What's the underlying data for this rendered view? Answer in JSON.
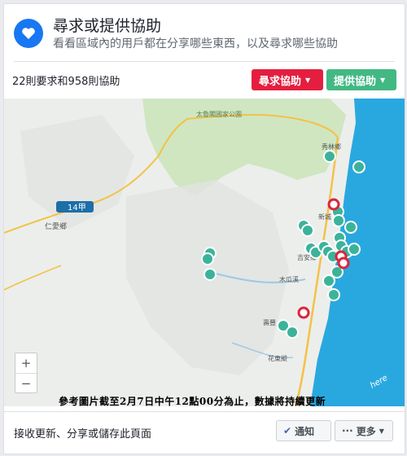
{
  "header": {
    "title": "尋求或提供協助",
    "subtitle": "看看區域內的用戶都在分享哪些東西，以及尋求哪些協助"
  },
  "summary": "22則要求和958則協助",
  "buttons": {
    "request": "尋求協助",
    "offer": "提供協助"
  },
  "map": {
    "labels": {
      "park": "太魯閣國家公園",
      "road14": "14甲",
      "renai": "仁愛鄉",
      "xiulin": "秀林鄉",
      "xincheng": "新城",
      "jian": "吉安鄉",
      "river": "木瓜溪",
      "shoufeng": "壽豐",
      "huadong": "花東縱",
      "here": "here"
    },
    "zoom": {
      "in": "+",
      "out": "−"
    },
    "colors": {
      "request": "#d9263d",
      "offer": "#3bb39a",
      "sea": "#29a8df"
    }
  },
  "caption": "參考圖片截至2月7日中午12點00分為止，數據將持續更新",
  "footer": {
    "text": "接收更新、分享或儲存此頁面",
    "notify": "通知",
    "more": "更多"
  }
}
